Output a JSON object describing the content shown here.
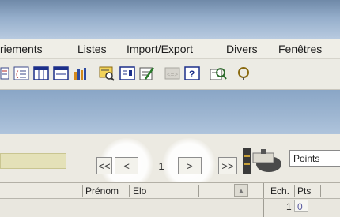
{
  "menu": {
    "items": [
      "riements",
      "Listes",
      "Import/Export",
      "Divers",
      "Fenêtres"
    ]
  },
  "toolbar": {
    "icons": [
      "list-icon",
      "numbered-list-icon",
      "columns-icon",
      "window-icon",
      "chart-icon",
      "search-icon",
      "card-icon",
      "edit-icon",
      "arrows-icon",
      "help-icon",
      "find-icon",
      "tool-icon"
    ]
  },
  "navigation": {
    "first_label": "<<",
    "prev_label": "<",
    "page": "1",
    "next_label": ">",
    "last_label": ">>"
  },
  "sort_field": {
    "value": "Points"
  },
  "table": {
    "columns": [
      "Prénom",
      "Elo"
    ],
    "scroll_up": "▲"
  },
  "standings": {
    "columns": [
      "Ech.",
      "Pts"
    ],
    "rows": [
      {
        "ech": "1",
        "pts": "0"
      }
    ]
  },
  "colors": {
    "menu_bg": "#efeee7",
    "title_gradient_top": "#6f89a8",
    "highlight_glow": "#ffffff",
    "field_yellow": "#e4e1b8"
  }
}
